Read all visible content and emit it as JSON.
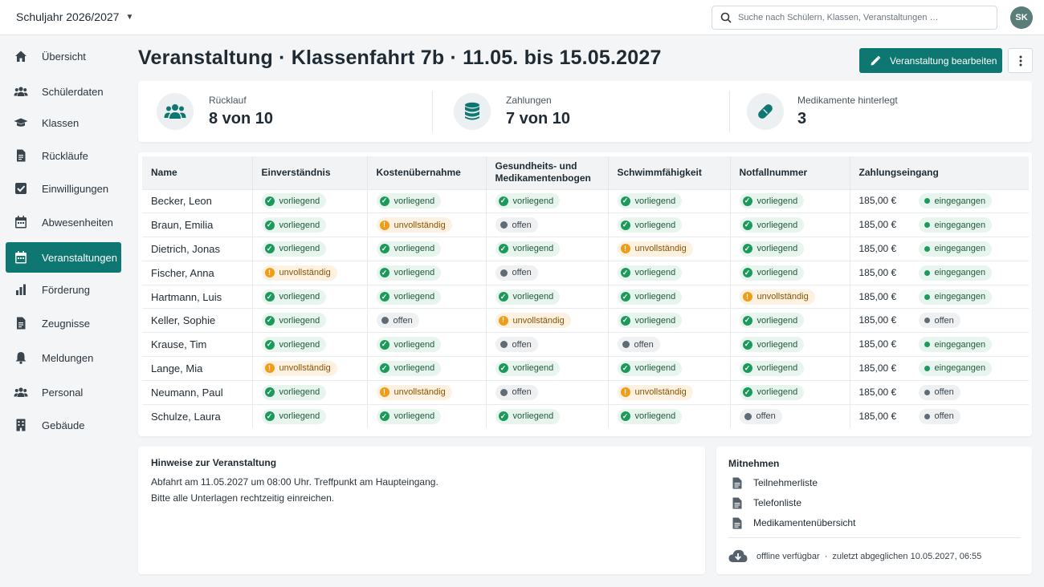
{
  "topbar": {
    "school_year": "Schuljahr 2026/2027",
    "search_placeholder": "Suche nach Schülern, Klassen, Veranstaltungen …",
    "avatar_initials": "SK"
  },
  "sidebar": {
    "items": [
      {
        "label": "Übersicht",
        "icon": "home-icon"
      },
      {
        "label": "Schülerdaten",
        "icon": "users-icon"
      },
      {
        "label": "Klassen",
        "icon": "graduation-cap-icon"
      },
      {
        "label": "Rückläufe",
        "icon": "document-icon"
      },
      {
        "label": "Einwilligungen",
        "icon": "checkbox-icon"
      },
      {
        "label": "Abwesenheiten",
        "icon": "calendar-icon"
      },
      {
        "label": "Veranstaltungen",
        "icon": "calendar-icon",
        "active": true
      },
      {
        "label": "Förderung",
        "icon": "bar-chart-icon"
      },
      {
        "label": "Zeugnisse",
        "icon": "document-icon"
      },
      {
        "label": "Meldungen",
        "icon": "bell-icon"
      },
      {
        "label": "Personal",
        "icon": "users-icon"
      },
      {
        "label": "Gebäude",
        "icon": "building-icon"
      }
    ]
  },
  "header": {
    "title": "Veranstaltung · Klassenfahrt 7b · 11.05. bis 15.05.2027",
    "edit_button": "Veranstaltung bearbeiten"
  },
  "stats": [
    {
      "label": "Rücklauf",
      "value": "8 von 10",
      "icon": "users-icon"
    },
    {
      "label": "Zahlungen",
      "value": "7 von 10",
      "icon": "database-icon"
    },
    {
      "label": "Medikamente hinterlegt",
      "value": "3",
      "icon": "pill-icon"
    }
  ],
  "table": {
    "headers": [
      "Name",
      "Einverständnis",
      "Kostenübernahme",
      "Gesundheits- und Medikamentenbogen",
      "Schwimmfähigkeit",
      "Notfallnummer",
      "Zahlungseingang"
    ],
    "rows": [
      {
        "name": "Becker, Leon",
        "cells": [
          "vorliegend",
          "vorliegend",
          "vorliegend",
          "vorliegend",
          "vorliegend"
        ],
        "amount": "185,00 €",
        "payment": "eingegangen"
      },
      {
        "name": "Braun, Emilia",
        "cells": [
          "vorliegend",
          "unvollständig",
          "offen",
          "vorliegend",
          "vorliegend"
        ],
        "amount": "185,00 €",
        "payment": "eingegangen"
      },
      {
        "name": "Dietrich, Jonas",
        "cells": [
          "vorliegend",
          "vorliegend",
          "vorliegend",
          "unvollständig",
          "vorliegend"
        ],
        "amount": "185,00 €",
        "payment": "eingegangen"
      },
      {
        "name": "Fischer, Anna",
        "cells": [
          "unvollständig",
          "vorliegend",
          "offen",
          "vorliegend",
          "vorliegend"
        ],
        "amount": "185,00 €",
        "payment": "eingegangen"
      },
      {
        "name": "Hartmann, Luis",
        "cells": [
          "vorliegend",
          "vorliegend",
          "vorliegend",
          "vorliegend",
          "unvollständig"
        ],
        "amount": "185,00 €",
        "payment": "eingegangen"
      },
      {
        "name": "Keller, Sophie",
        "cells": [
          "vorliegend",
          "offen",
          "unvollständig",
          "vorliegend",
          "vorliegend"
        ],
        "amount": "185,00 €",
        "payment": "offen"
      },
      {
        "name": "Krause, Tim",
        "cells": [
          "vorliegend",
          "vorliegend",
          "offen",
          "offen",
          "vorliegend"
        ],
        "amount": "185,00 €",
        "payment": "eingegangen"
      },
      {
        "name": "Lange, Mia",
        "cells": [
          "unvollständig",
          "vorliegend",
          "vorliegend",
          "vorliegend",
          "vorliegend"
        ],
        "amount": "185,00 €",
        "payment": "eingegangen"
      },
      {
        "name": "Neumann, Paul",
        "cells": [
          "vorliegend",
          "unvollständig",
          "offen",
          "unvollständig",
          "vorliegend"
        ],
        "amount": "185,00 €",
        "payment": "offen"
      },
      {
        "name": "Schulze, Laura",
        "cells": [
          "vorliegend",
          "vorliegend",
          "vorliegend",
          "vorliegend",
          "offen"
        ],
        "amount": "185,00 €",
        "payment": "offen"
      }
    ]
  },
  "notes": {
    "title": "Hinweise zur Veranstaltung",
    "line1": "Abfahrt am 11.05.2027 um 08:00 Uhr. Treffpunkt am Haupteingang.",
    "line2": "Bitte alle Unterlagen rechtzeitig einreichen."
  },
  "take_along": {
    "title": "Mitnehmen",
    "items": [
      "Teilnehmerliste",
      "Telefonliste",
      "Medikamentenübersicht"
    ],
    "offline": "offline verfügbar",
    "separator": "·",
    "synced": "zuletzt abgeglichen 10.05.2027, 06:55"
  },
  "colors": {
    "accent": "#0e7771",
    "ok": "#1c9a5a",
    "warn": "#f29b17",
    "open": "#5f6b75"
  }
}
